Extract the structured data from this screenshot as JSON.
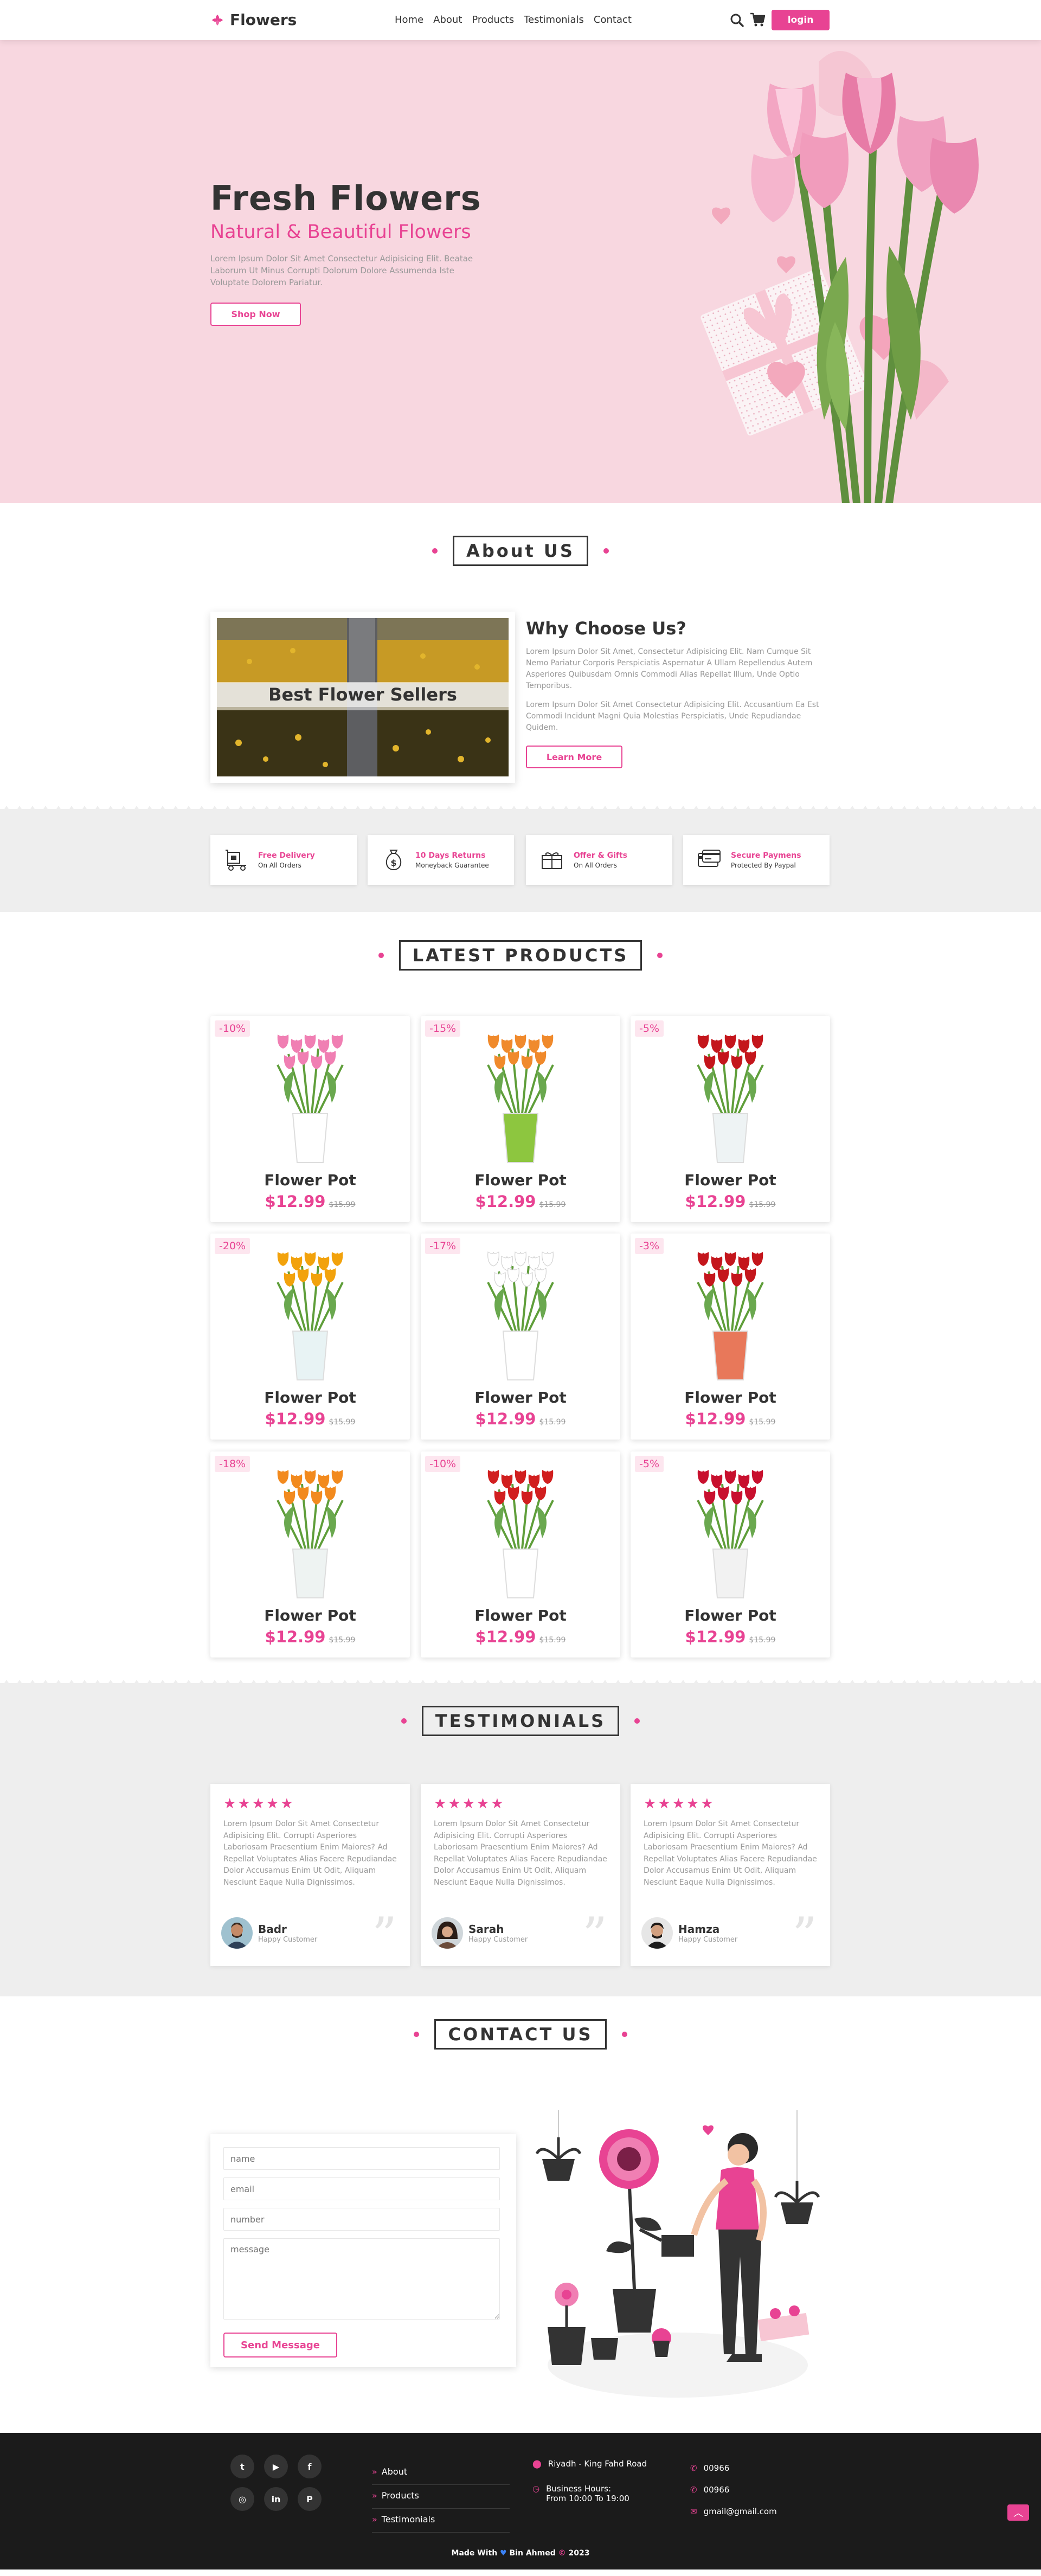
{
  "brand": {
    "name": "Flowers",
    "accent": "#e84393",
    "dark": "#333333",
    "hero_bg": "#f8d7e0",
    "section_gray": "#eeeeee",
    "footer_bg": "#1b1b1b"
  },
  "nav": {
    "links": [
      "Home",
      "About",
      "Products",
      "Testimonials",
      "Contact"
    ],
    "login": "login",
    "icons": [
      "search-icon",
      "cart-icon"
    ]
  },
  "hero": {
    "title": "Fresh Flowers",
    "subtitle": "Natural & Beautiful Flowers",
    "description": "Lorem Ipsum Dolor Sit Amet Consectetur Adipisicing Elit. Beatae Laborum Ut Minus Corrupti Dolorum Dolore Assumenda Iste Voluptate Dolorem Pariatur.",
    "button": "Shop Now"
  },
  "about": {
    "heading": "About US",
    "image_caption": "Best Flower Sellers",
    "title": "Why Choose Us?",
    "p1": "Lorem Ipsum Dolor Sit Amet, Consectetur Adipisicing Elit. Nam Cumque Sit Nemo Pariatur Corporis Perspiciatis Aspernatur A Ullam Repellendus Autem Asperiores Quibusdam Omnis Commodi Alias Repellat Illum, Unde Optio Temporibus.",
    "p2": "Lorem Ipsum Dolor Sit Amet Consectetur Adipisicing Elit. Accusantium Ea Est Commodi Incidunt Magni Quia Molestias Perspiciatis, Unde Repudiandae Quidem.",
    "button": "Learn More"
  },
  "features": [
    {
      "title": "Free Delivery",
      "sub": "On All Orders",
      "icon": "delivery-icon"
    },
    {
      "title": "10 Days Returns",
      "sub": "Moneyback Guarantee",
      "icon": "money-icon"
    },
    {
      "title": "Offer & Gifts",
      "sub": "On All Orders",
      "icon": "gift-icon"
    },
    {
      "title": "Secure Paymens",
      "sub": "Protected By Paypal",
      "icon": "card-icon"
    }
  ],
  "products": {
    "heading": "LATEST PRODUCTS",
    "items": [
      {
        "discount": "-10%",
        "name": "Flower Pot",
        "price": "$12.99",
        "old": "$15.99"
      },
      {
        "discount": "-15%",
        "name": "Flower Pot",
        "price": "$12.99",
        "old": "$15.99"
      },
      {
        "discount": "-5%",
        "name": "Flower Pot",
        "price": "$12.99",
        "old": "$15.99"
      },
      {
        "discount": "-20%",
        "name": "Flower Pot",
        "price": "$12.99",
        "old": "$15.99"
      },
      {
        "discount": "-17%",
        "name": "Flower Pot",
        "price": "$12.99",
        "old": "$15.99"
      },
      {
        "discount": "-3%",
        "name": "Flower Pot",
        "price": "$12.99",
        "old": "$15.99"
      },
      {
        "discount": "-18%",
        "name": "Flower Pot",
        "price": "$12.99",
        "old": "$15.99"
      },
      {
        "discount": "-10%",
        "name": "Flower Pot",
        "price": "$12.99",
        "old": "$15.99"
      },
      {
        "discount": "-5%",
        "name": "Flower Pot",
        "price": "$12.99",
        "old": "$15.99"
      }
    ]
  },
  "testimonials": {
    "heading": "TESTIMONIALS",
    "items": [
      {
        "stars": "★★★★★",
        "text": "Lorem Ipsum Dolor Sit Amet Consectetur Adipisicing Elit. Corrupti Asperiores Laboriosam Praesentium Enim Maiores? Ad Repellat Voluptates Alias Facere Repudiandae Dolor Accusamus Enim Ut Odit, Aliquam Nesciunt Eaque Nulla Dignissimos.",
        "name": "Badr",
        "role": "Happy Customer"
      },
      {
        "stars": "★★★★★",
        "text": "Lorem Ipsum Dolor Sit Amet Consectetur Adipisicing Elit. Corrupti Asperiores Laboriosam Praesentium Enim Maiores? Ad Repellat Voluptates Alias Facere Repudiandae Dolor Accusamus Enim Ut Odit, Aliquam Nesciunt Eaque Nulla Dignissimos.",
        "name": "Sarah",
        "role": "Happy Customer"
      },
      {
        "stars": "★★★★★",
        "text": "Lorem Ipsum Dolor Sit Amet Consectetur Adipisicing Elit. Corrupti Asperiores Laboriosam Praesentium Enim Maiores? Ad Repellat Voluptates Alias Facere Repudiandae Dolor Accusamus Enim Ut Odit, Aliquam Nesciunt Eaque Nulla Dignissimos.",
        "name": "Hamza",
        "role": "Happy Customer"
      }
    ]
  },
  "contact": {
    "heading": "CONTACT US",
    "placeholders": {
      "name": "name",
      "email": "email",
      "number": "number",
      "message": "message"
    },
    "button": "Send Message"
  },
  "footer": {
    "socials": [
      "twitter-icon",
      "youtube-icon",
      "facebook-icon",
      "instagram-icon",
      "linkedin-icon",
      "pinterest-icon"
    ],
    "links": [
      "About",
      "Products",
      "Testimonials"
    ],
    "address": "Riyadh - King Fahd Road",
    "hours_label": "Business Hours:",
    "hours": "From 10:00 To 19:00",
    "phone1": "00966",
    "phone2": "00966",
    "email": "gmail@gmail.com",
    "credit_prefix": "Made With",
    "credit_name": "Bin Ahmed",
    "credit_year": "2023"
  }
}
